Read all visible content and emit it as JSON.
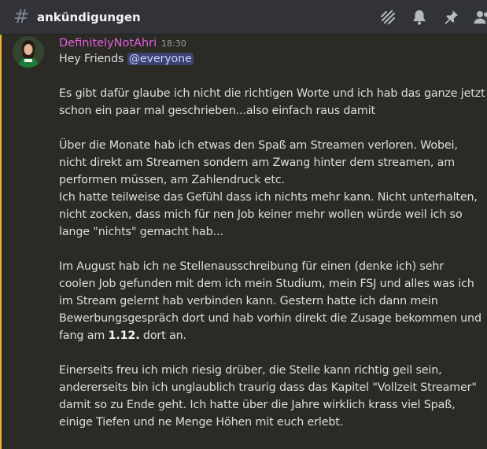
{
  "header": {
    "channel_name": "ankündigungen",
    "icons": [
      "threads-icon",
      "bell-icon",
      "pin-icon",
      "members-icon"
    ]
  },
  "message": {
    "author": "DefinitelyNotAhri",
    "timestamp": "18:30",
    "accent_color": "#f0b232",
    "username_color": "#e060e0",
    "greeting": "Hey Friends",
    "mention": "@everyone",
    "lines": [
      "Es gibt dafür glaube ich nicht die richtigen Worte und ich hab das ganze jetzt",
      "schon ein paar mal geschrieben...also einfach raus damit",
      "Über die Monate hab ich etwas den Spaß am Streamen verloren. Wobei,",
      "nicht direkt am Streamen sondern am Zwang hinter dem streamen, am",
      "performen müssen, am Zahlendruck etc.",
      "Ich hatte teilweise das Gefühl dass ich nichts mehr kann. Nicht unterhalten,",
      "nicht zocken, dass mich für nen Job keiner mehr wollen würde weil ich so",
      "lange \"nichts\" gemacht hab...",
      "Im August hab ich ne Stellenausschreibung für einen (denke ich) sehr",
      "coolen Job gefunden mit dem ich mein Studium, mein FSJ und alles was ich",
      "im Stream gelernt hab verbinden kann. Gestern hatte ich dann mein",
      "Bewerbungsgespräch dort und hab vorhin direkt die Zusage bekommen und",
      "fang am",
      "1.12.",
      "dort an.",
      "Einerseits freu ich mich riesig drüber, die Stelle kann richtig geil sein,",
      "andererseits bin ich unglaublich traurig dass das Kapitel \"Vollzeit Streamer\"",
      "damit so zu Ende geht. Ich hatte über die Jahre wirklich krass viel Spaß,",
      "einige Tiefen und ne Menge Höhen mit euch erlebt."
    ]
  }
}
